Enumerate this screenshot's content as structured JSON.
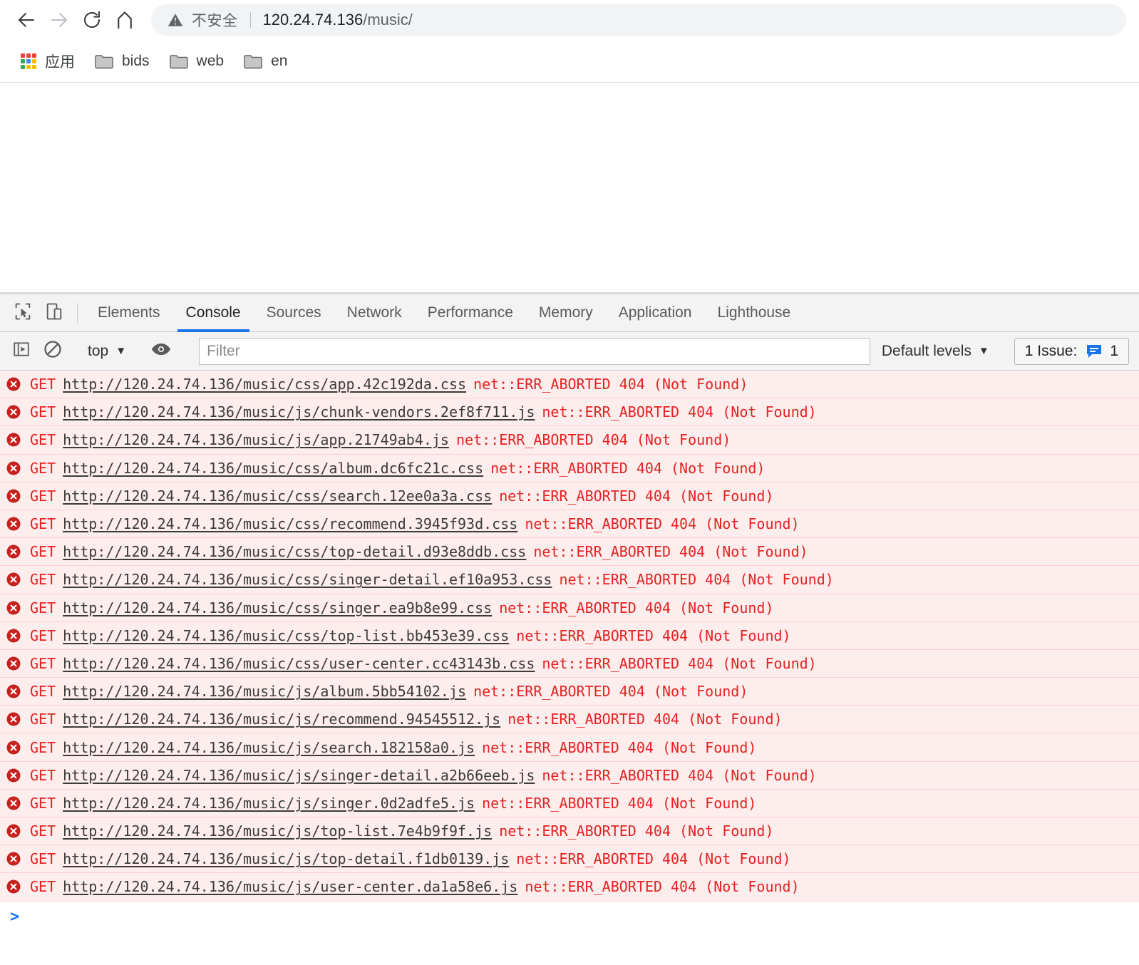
{
  "browser": {
    "nav": {
      "back_label": "Back",
      "forward_label": "Forward",
      "reload_label": "Reload",
      "home_label": "Home"
    },
    "omnibox": {
      "security_label": "不安全",
      "url_host": "120.24.74.136",
      "url_path": "/music/"
    },
    "bookmarks": {
      "apps_label": "应用",
      "items": [
        {
          "label": "bids"
        },
        {
          "label": "web"
        },
        {
          "label": "en"
        }
      ]
    }
  },
  "devtools": {
    "tabs": [
      {
        "label": "Elements",
        "active": false
      },
      {
        "label": "Console",
        "active": true
      },
      {
        "label": "Sources",
        "active": false
      },
      {
        "label": "Network",
        "active": false
      },
      {
        "label": "Performance",
        "active": false
      },
      {
        "label": "Memory",
        "active": false
      },
      {
        "label": "Application",
        "active": false
      },
      {
        "label": "Lighthouse",
        "active": false
      }
    ],
    "toolbar": {
      "context_value": "top",
      "caret": "▼",
      "filter_placeholder": "Filter",
      "filter_value": "",
      "levels_value": "Default levels",
      "issues_text": "1 Issue:",
      "issues_count": "1"
    },
    "console": {
      "prompt": ">",
      "messages": [
        {
          "method": "GET",
          "url": "http://120.24.74.136/music/css/app.42c192da.css",
          "error": "net::ERR_ABORTED 404 (Not Found)"
        },
        {
          "method": "GET",
          "url": "http://120.24.74.136/music/js/chunk-vendors.2ef8f711.js",
          "error": "net::ERR_ABORTED 404 (Not Found)"
        },
        {
          "method": "GET",
          "url": "http://120.24.74.136/music/js/app.21749ab4.js",
          "error": "net::ERR_ABORTED 404 (Not Found)"
        },
        {
          "method": "GET",
          "url": "http://120.24.74.136/music/css/album.dc6fc21c.css",
          "error": "net::ERR_ABORTED 404 (Not Found)"
        },
        {
          "method": "GET",
          "url": "http://120.24.74.136/music/css/search.12ee0a3a.css",
          "error": "net::ERR_ABORTED 404 (Not Found)"
        },
        {
          "method": "GET",
          "url": "http://120.24.74.136/music/css/recommend.3945f93d.css",
          "error": "net::ERR_ABORTED 404 (Not Found)"
        },
        {
          "method": "GET",
          "url": "http://120.24.74.136/music/css/top-detail.d93e8ddb.css",
          "error": "net::ERR_ABORTED 404 (Not Found)"
        },
        {
          "method": "GET",
          "url": "http://120.24.74.136/music/css/singer-detail.ef10a953.css",
          "error": "net::ERR_ABORTED 404 (Not Found)"
        },
        {
          "method": "GET",
          "url": "http://120.24.74.136/music/css/singer.ea9b8e99.css",
          "error": "net::ERR_ABORTED 404 (Not Found)"
        },
        {
          "method": "GET",
          "url": "http://120.24.74.136/music/css/top-list.bb453e39.css",
          "error": "net::ERR_ABORTED 404 (Not Found)"
        },
        {
          "method": "GET",
          "url": "http://120.24.74.136/music/css/user-center.cc43143b.css",
          "error": "net::ERR_ABORTED 404 (Not Found)"
        },
        {
          "method": "GET",
          "url": "http://120.24.74.136/music/js/album.5bb54102.js",
          "error": "net::ERR_ABORTED 404 (Not Found)"
        },
        {
          "method": "GET",
          "url": "http://120.24.74.136/music/js/recommend.94545512.js",
          "error": "net::ERR_ABORTED 404 (Not Found)"
        },
        {
          "method": "GET",
          "url": "http://120.24.74.136/music/js/search.182158a0.js",
          "error": "net::ERR_ABORTED 404 (Not Found)"
        },
        {
          "method": "GET",
          "url": "http://120.24.74.136/music/js/singer-detail.a2b66eeb.js",
          "error": "net::ERR_ABORTED 404 (Not Found)"
        },
        {
          "method": "GET",
          "url": "http://120.24.74.136/music/js/singer.0d2adfe5.js",
          "error": "net::ERR_ABORTED 404 (Not Found)"
        },
        {
          "method": "GET",
          "url": "http://120.24.74.136/music/js/top-list.7e4b9f9f.js",
          "error": "net::ERR_ABORTED 404 (Not Found)"
        },
        {
          "method": "GET",
          "url": "http://120.24.74.136/music/js/top-detail.f1db0139.js",
          "error": "net::ERR_ABORTED 404 (Not Found)"
        },
        {
          "method": "GET",
          "url": "http://120.24.74.136/music/js/user-center.da1a58e6.js",
          "error": "net::ERR_ABORTED 404 (Not Found)"
        }
      ]
    }
  },
  "colors": {
    "error_text": "#e52222",
    "error_row_bg": "#fdeded",
    "accent_blue": "#1a73e8",
    "issue_blue": "#1a73e8"
  }
}
